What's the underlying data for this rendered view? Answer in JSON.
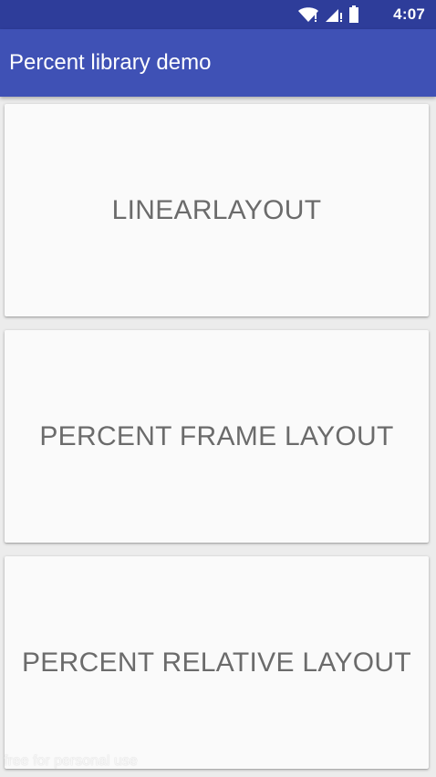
{
  "status_bar": {
    "time": "4:07",
    "icons": [
      "wifi-icon",
      "cell-signal-icon",
      "battery-icon"
    ]
  },
  "app_bar": {
    "title": "Percent library demo",
    "color": "#3f51b5",
    "status_color": "#2e3d9a"
  },
  "cards": [
    {
      "label": "LINEARLAYOUT"
    },
    {
      "label": "PERCENT FRAME LAYOUT"
    },
    {
      "label": "PERCENT RELATIVE LAYOUT"
    }
  ],
  "watermark": "free for personal use"
}
